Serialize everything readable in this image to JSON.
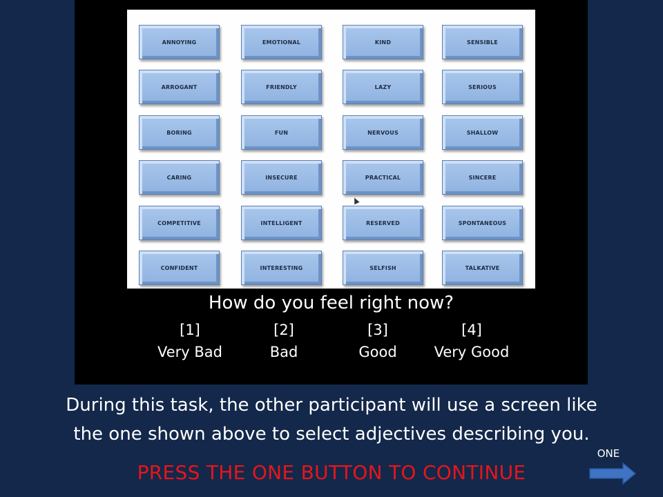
{
  "adjectives": [
    [
      "ANNOYING",
      "EMOTIONAL",
      "KIND",
      "SENSIBLE"
    ],
    [
      "ARROGANT",
      "FRIENDLY",
      "LAZY",
      "SERIOUS"
    ],
    [
      "BORING",
      "FUN",
      "NERVOUS",
      "SHALLOW"
    ],
    [
      "CARING",
      "INSECURE",
      "PRACTICAL",
      "SINCERE"
    ],
    [
      "COMPETITIVE",
      "INTELLIGENT",
      "RESERVED",
      "SPONTANEOUS"
    ],
    [
      "CONFIDENT",
      "INTERESTING",
      "SELFISH",
      "TALKATIVE"
    ]
  ],
  "question": "How do you feel right now?",
  "rating_options": [
    {
      "key": "[1]",
      "label": "Very Bad"
    },
    {
      "key": "[2]",
      "label": "Bad"
    },
    {
      "key": "[3]",
      "label": "Good"
    },
    {
      "key": "[4]",
      "label": "Very Good"
    }
  ],
  "instruction_line1": "During this task, the other participant will use a screen like",
  "instruction_line2": "the one shown above to select adjectives describing you.",
  "continue_prompt": "PRESS THE ONE BUTTON TO CONTINUE",
  "next_button_label": "ONE",
  "colors": {
    "background": "#13284a",
    "button_fill": "#9dbde6",
    "prompt_red": "#e8151b",
    "arrow_blue": "#3f74c4"
  }
}
